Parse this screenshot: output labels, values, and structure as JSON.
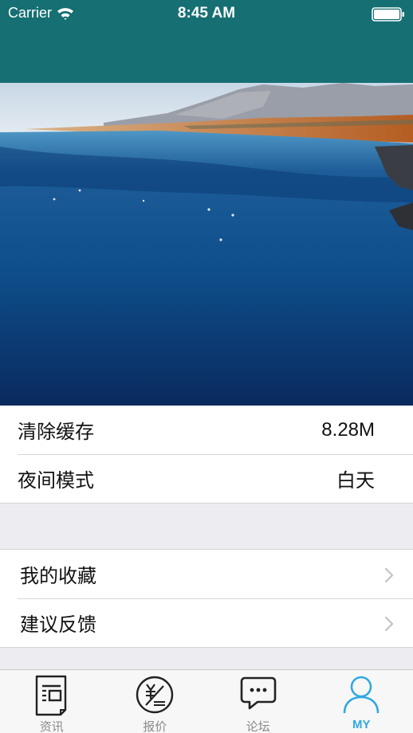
{
  "status_bar": {
    "carrier": "Carrier",
    "time": "8:45 AM"
  },
  "colors": {
    "header": "#166f73",
    "active_tab": "#2fa9e1",
    "inactive_tab": "#8a8a8a"
  },
  "hero": {
    "icon": "lake-landscape-photo"
  },
  "settings": {
    "clear_cache": {
      "label": "清除缓存",
      "value": "8.28M"
    },
    "night_mode": {
      "label": "夜间模式",
      "value": "白天"
    }
  },
  "links": {
    "favorites": {
      "label": "我的收藏",
      "icon": "chevron-right-icon"
    },
    "feedback": {
      "label": "建议反馈",
      "icon": "chevron-right-icon"
    }
  },
  "tabs": [
    {
      "label": "资讯",
      "icon": "news-icon",
      "active": false
    },
    {
      "label": "报价",
      "icon": "yuan-icon",
      "active": false
    },
    {
      "label": "论坛",
      "icon": "chat-bubble-icon",
      "active": false
    },
    {
      "label": "MY",
      "icon": "person-icon",
      "active": true
    }
  ]
}
